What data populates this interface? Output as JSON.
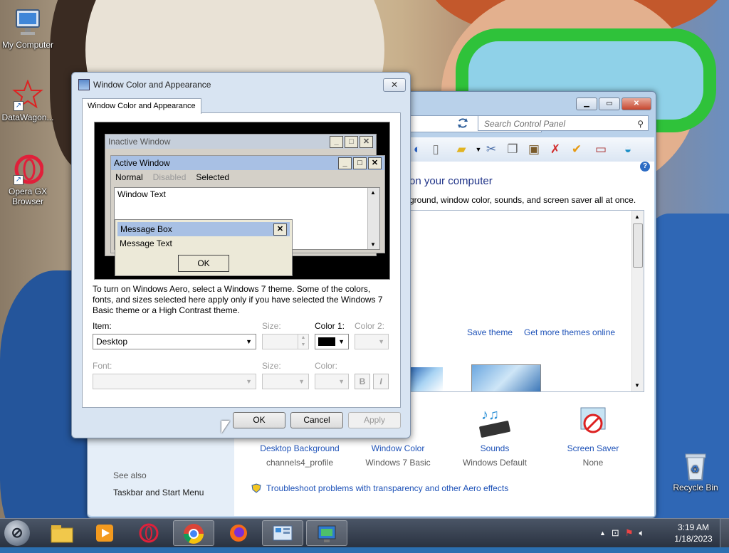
{
  "desktop": {
    "icons": [
      {
        "label": "My Computer",
        "icon": "computer-icon"
      },
      {
        "label": "DataWagon...",
        "icon": "datawagon-icon"
      },
      {
        "label": "Opera GX Browser",
        "icon": "opera-gx-icon"
      },
      {
        "label": "Recycle Bin",
        "icon": "recycle-bin-icon"
      }
    ]
  },
  "control_panel": {
    "search_placeholder": "Search Control Panel",
    "heading": "on your computer",
    "subtext": "ground, window color, sounds, and screen saver all at once.",
    "save_theme": "Save theme",
    "get_more_themes": "Get more themes online",
    "items": [
      {
        "label": "Desktop Background",
        "sub": "channels4_profile",
        "icon": "desktop-background-icon"
      },
      {
        "label": "Window Color",
        "sub": "Windows 7 Basic",
        "icon": "window-color-icon"
      },
      {
        "label": "Sounds",
        "sub": "Windows Default",
        "icon": "sounds-icon"
      },
      {
        "label": "Screen Saver",
        "sub": "None",
        "icon": "screen-saver-icon"
      }
    ],
    "see_also": "See also",
    "taskbar_link": "Taskbar and Start Menu",
    "troubleshoot": "Troubleshoot problems with transparency and other Aero effects"
  },
  "dialog": {
    "title": "Window Color and Appearance",
    "tab": "Window Color and Appearance",
    "preview": {
      "inactive_title": "Inactive Window",
      "active_title": "Active Window",
      "menu_normal": "Normal",
      "menu_disabled": "Disabled",
      "menu_selected": "Selected",
      "window_text": "Window Text",
      "msg_title": "Message Box",
      "msg_text": "Message Text",
      "msg_ok": "OK"
    },
    "description": "To turn on Windows Aero, select a Windows 7 theme.  Some of the colors, fonts, and sizes selected here apply only if you have selected the Windows 7 Basic theme or a High Contrast theme.",
    "item_label": "Item:",
    "item_value": "Desktop",
    "size_label": "Size:",
    "color1_label": "Color 1:",
    "color1_value": "#000000",
    "color2_label": "Color 2:",
    "font_label": "Font:",
    "font_size_label": "Size:",
    "font_color_label": "Color:",
    "bold": "B",
    "italic": "I",
    "ok": "OK",
    "cancel": "Cancel",
    "apply": "Apply"
  },
  "taskbar": {
    "time": "3:19 AM",
    "date": "1/18/2023",
    "apps": [
      "file-explorer-icon",
      "media-player-icon",
      "opera-gx-icon",
      "chrome-icon",
      "firefox-icon",
      "control-panel-icon",
      "display-settings-icon"
    ]
  }
}
